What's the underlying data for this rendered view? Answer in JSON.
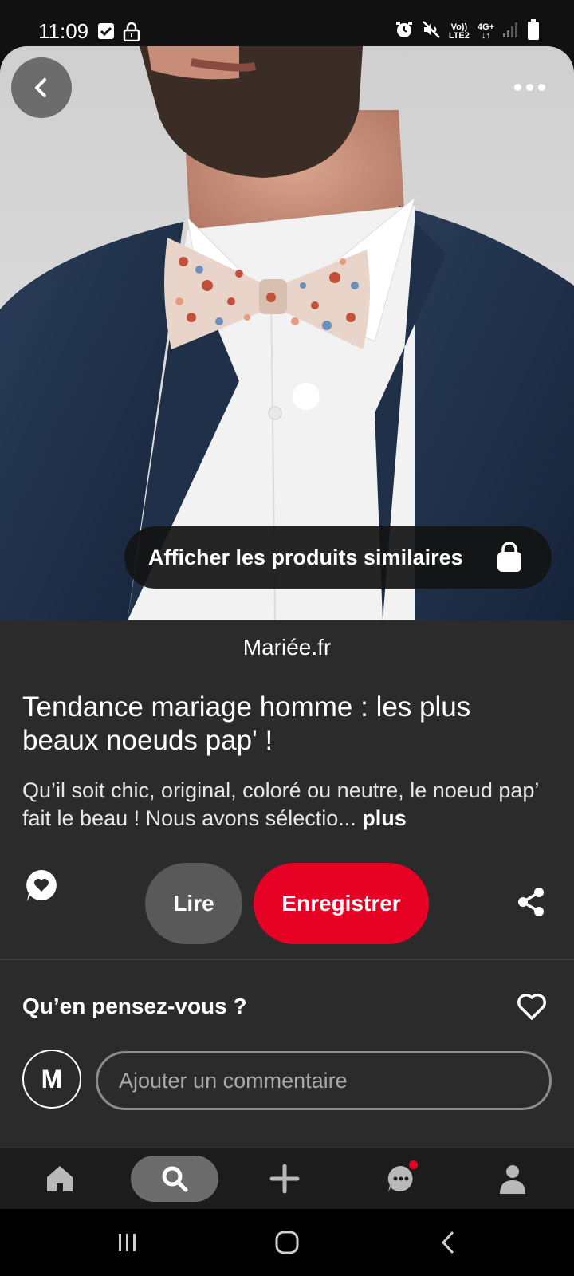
{
  "status_bar": {
    "time": "11:09",
    "volte": "Vo))",
    "lte": "LTE2",
    "network": "4G+"
  },
  "pin": {
    "image_description_icon": "bow-tie-photo",
    "similar_products_label": "Afficher les produits similaires",
    "source": "Mariée.fr",
    "title": "Tendance mariage homme : les plus beaux noeuds pap' !",
    "description": "Qu’il soit chic, original, coloré ou neutre, le noeud pap’ fait le beau ! Nous avons sélectio...",
    "more_label": "plus"
  },
  "actions": {
    "read_label": "Lire",
    "save_label": "Enregistrer"
  },
  "comments": {
    "question": "Qu’en pensez-vous ?",
    "avatar_initial": "M",
    "placeholder": "Ajouter un commentaire"
  },
  "colors": {
    "accent": "#e60023",
    "card_bg": "#2b2b2b"
  }
}
